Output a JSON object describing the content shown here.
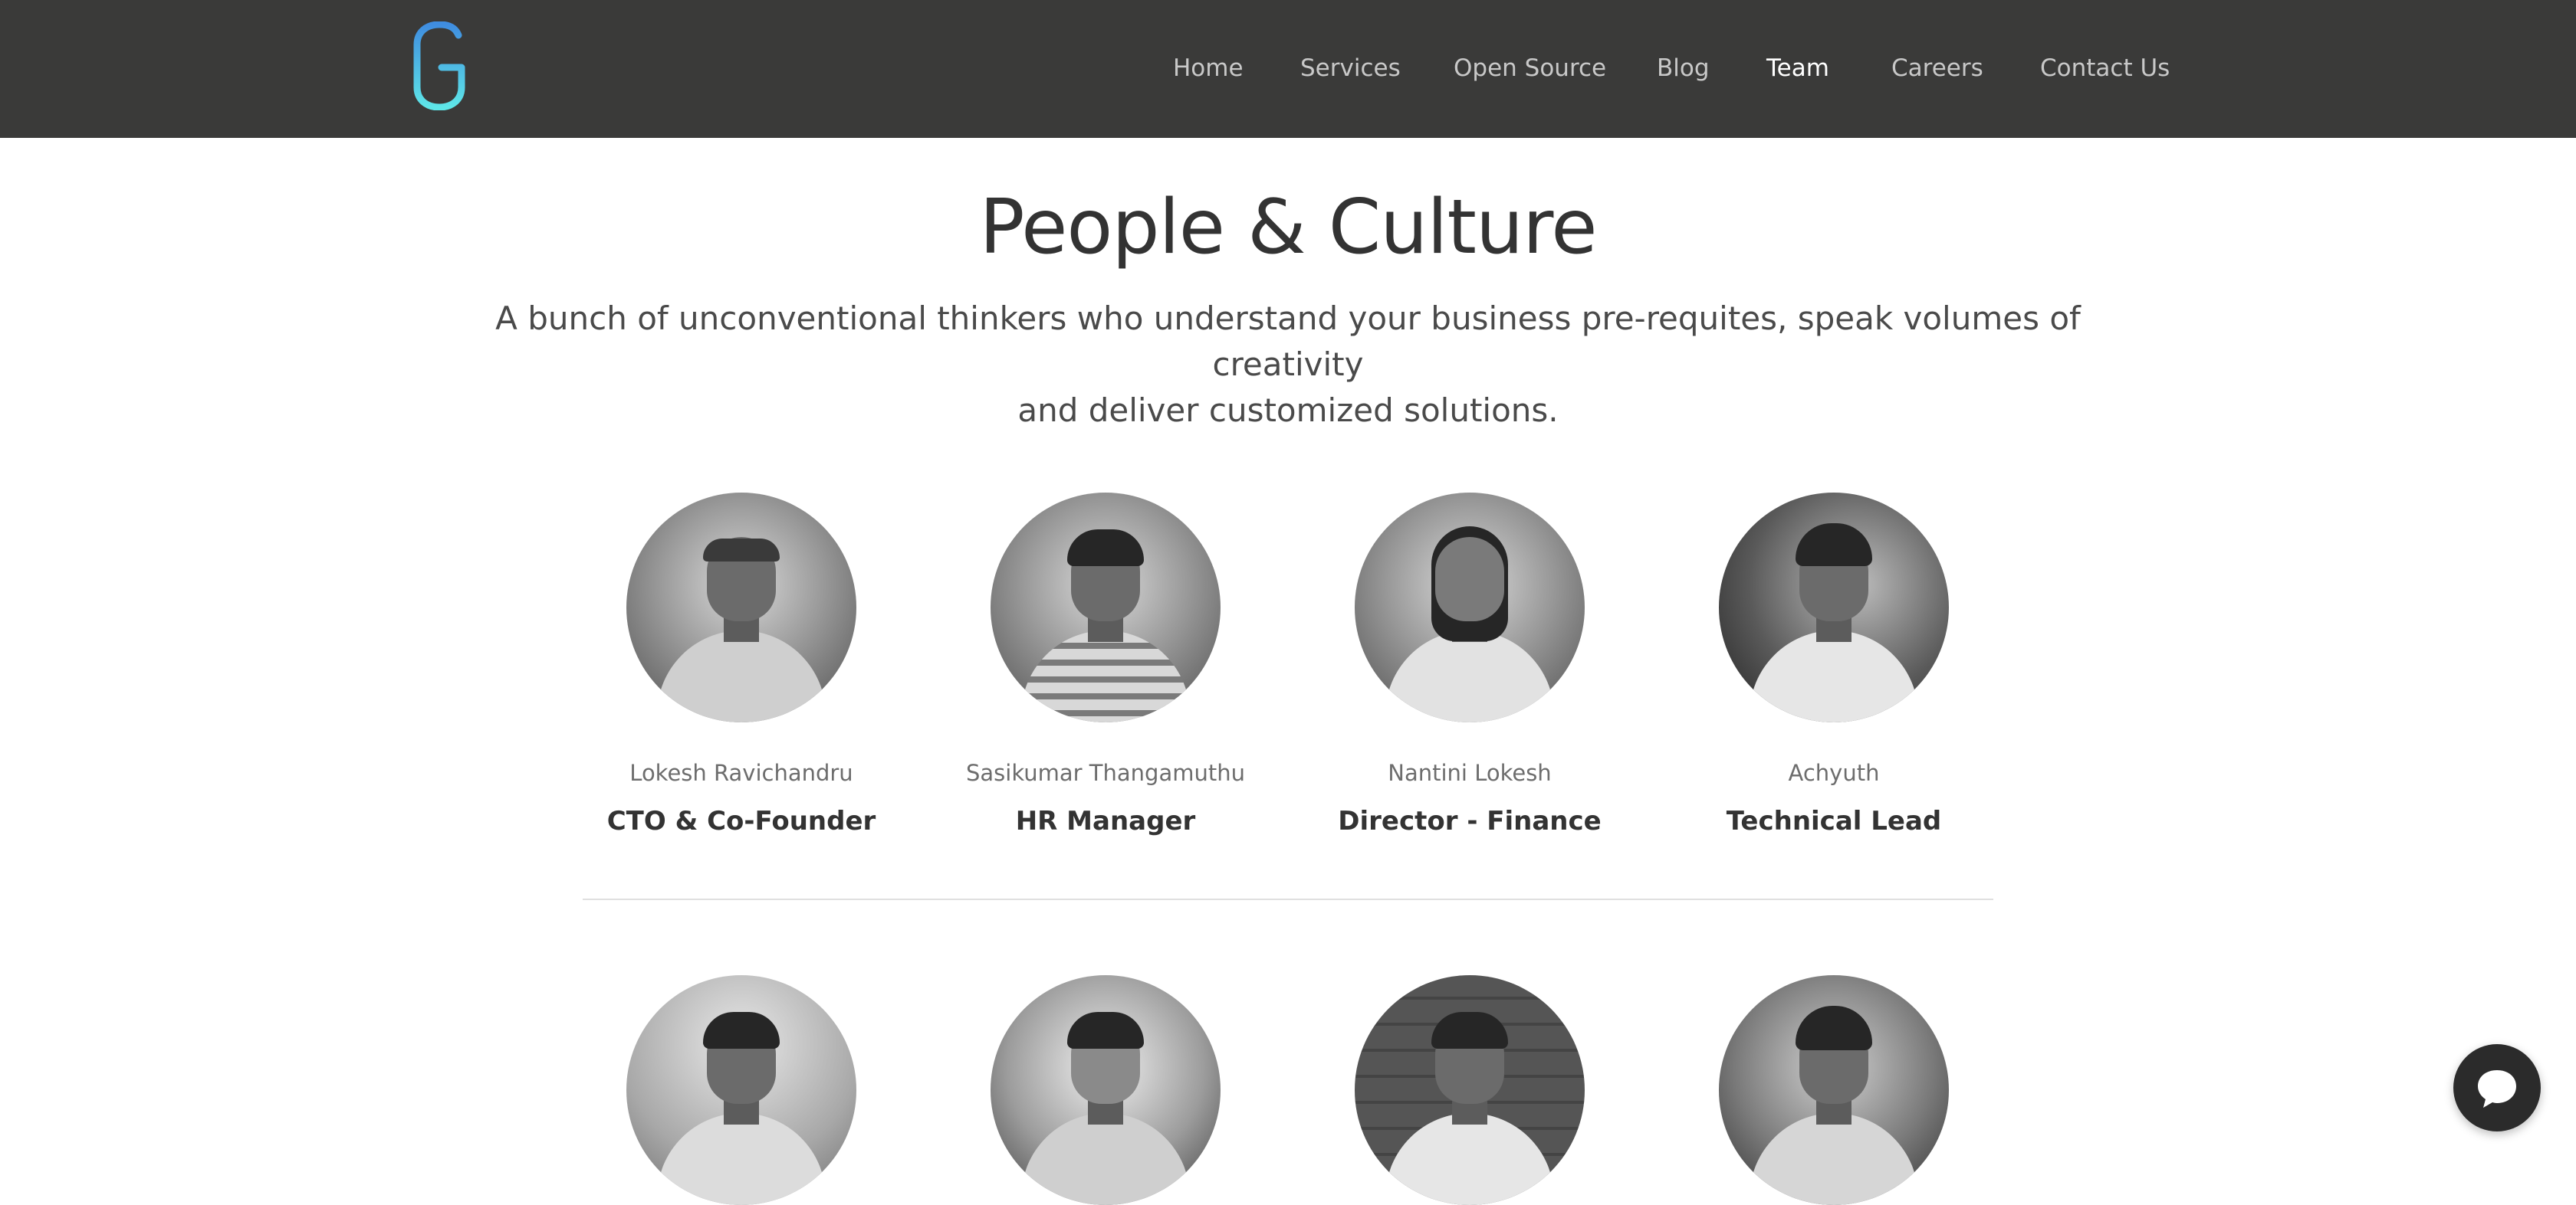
{
  "brand": {
    "logo_icon": "g-logo-icon",
    "gradient_top": "#3f8de0",
    "gradient_bottom": "#5ee6e8"
  },
  "nav": {
    "items": [
      {
        "label": "Home",
        "active": false
      },
      {
        "label": "Services",
        "active": false
      },
      {
        "label": "Open Source",
        "active": false
      },
      {
        "label": "Blog",
        "active": false
      },
      {
        "label": "Team",
        "active": true
      },
      {
        "label": "Careers",
        "active": false
      },
      {
        "label": "Contact Us",
        "active": false
      }
    ]
  },
  "hero": {
    "title": "People & Culture",
    "subtitle_line1": "A bunch of unconventional thinkers who understand your business pre-requites, speak volumes of creativity",
    "subtitle_line2": "and deliver customized solutions."
  },
  "team": {
    "row1": [
      {
        "name": "Lokesh Ravichandru",
        "role": "CTO & Co-Founder"
      },
      {
        "name": "Sasikumar Thangamuthu",
        "role": "HR Manager"
      },
      {
        "name": "Nantini Lokesh",
        "role": "Director - Finance"
      },
      {
        "name": "Achyuth",
        "role": "Technical Lead"
      }
    ]
  },
  "chat": {
    "icon": "chat-bubble-icon"
  },
  "colors": {
    "header_bg": "#3a3a39",
    "nav_text": "#c8c8c8",
    "nav_active": "#ffffff",
    "title_text": "#333333"
  }
}
